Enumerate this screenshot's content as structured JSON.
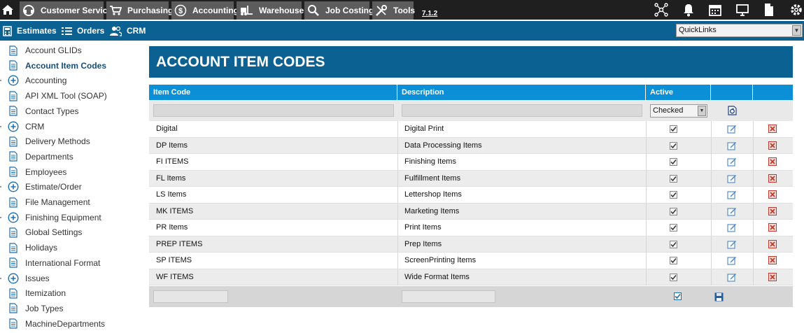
{
  "topbar": {
    "modules": [
      {
        "label": "Customer Service",
        "icon": "headset-icon"
      },
      {
        "label": "Purchasing",
        "icon": "cart-icon"
      },
      {
        "label": "Accounting",
        "icon": "dollar-icon"
      },
      {
        "label": "Warehouse",
        "icon": "forklift-icon"
      },
      {
        "label": "Job Costing",
        "icon": "search-icon"
      },
      {
        "label": "Tools",
        "icon": "tools-icon"
      }
    ],
    "version": "7.1.2",
    "right_icons": [
      "network-icon",
      "bell-icon",
      "calendar-icon",
      "monitor-icon",
      "document-icon",
      "gear-icon"
    ]
  },
  "subbar": {
    "items": [
      {
        "label": "Estimates",
        "icon": "calculator-icon"
      },
      {
        "label": "Orders",
        "icon": "list-icon"
      },
      {
        "label": "CRM",
        "icon": "people-icon"
      }
    ],
    "quicklinks": "QuickLinks"
  },
  "sidebar": {
    "items": [
      {
        "label": "Account GLIDs",
        "type": "page"
      },
      {
        "label": "Account Item Codes",
        "type": "page",
        "active": true
      },
      {
        "label": "Accounting",
        "type": "folder"
      },
      {
        "label": "API XML Tool (SOAP)",
        "type": "page"
      },
      {
        "label": "Contact Types",
        "type": "page"
      },
      {
        "label": "CRM",
        "type": "folder"
      },
      {
        "label": "Delivery Methods",
        "type": "page"
      },
      {
        "label": "Departments",
        "type": "page"
      },
      {
        "label": "Employees",
        "type": "page"
      },
      {
        "label": "Estimate/Order",
        "type": "folder"
      },
      {
        "label": "File Management",
        "type": "page"
      },
      {
        "label": "Finishing Equipment",
        "type": "folder"
      },
      {
        "label": "Global Settings",
        "type": "page"
      },
      {
        "label": "Holidays",
        "type": "page"
      },
      {
        "label": "International Format",
        "type": "page"
      },
      {
        "label": "Issues",
        "type": "folder"
      },
      {
        "label": "Itemization",
        "type": "page"
      },
      {
        "label": "Job Types",
        "type": "page"
      },
      {
        "label": "MachineDepartments",
        "type": "page"
      }
    ]
  },
  "page": {
    "title": "ACCOUNT ITEM CODES"
  },
  "grid": {
    "columns": [
      "Item Code",
      "Description",
      "Active"
    ],
    "filter": {
      "active_value": "Checked"
    },
    "rows": [
      {
        "code": "Digital",
        "description": "Digital Print",
        "active": true
      },
      {
        "code": "DP Items",
        "description": "Data Processing Items",
        "active": true
      },
      {
        "code": "FI ITEMS",
        "description": "Finishing Items",
        "active": true
      },
      {
        "code": "FL Items",
        "description": "Fulfillment Items",
        "active": true
      },
      {
        "code": "LS Items",
        "description": "Lettershop Items",
        "active": true
      },
      {
        "code": "MK ITEMS",
        "description": "Marketing Items",
        "active": true
      },
      {
        "code": "PR Items",
        "description": "Print Items",
        "active": true
      },
      {
        "code": "PREP ITEMS",
        "description": "Prep Items",
        "active": true
      },
      {
        "code": "SP ITEMS",
        "description": "ScreenPrinting Items",
        "active": true
      },
      {
        "code": "WF ITEMS",
        "description": "Wide Format Items",
        "active": true
      }
    ]
  },
  "colors": {
    "topbar": "#1f1f1f",
    "module_button": "#5c5c5c",
    "brand_blue": "#0b6192",
    "grid_header": "#0b8fd6",
    "delete_red": "#c0392b"
  }
}
